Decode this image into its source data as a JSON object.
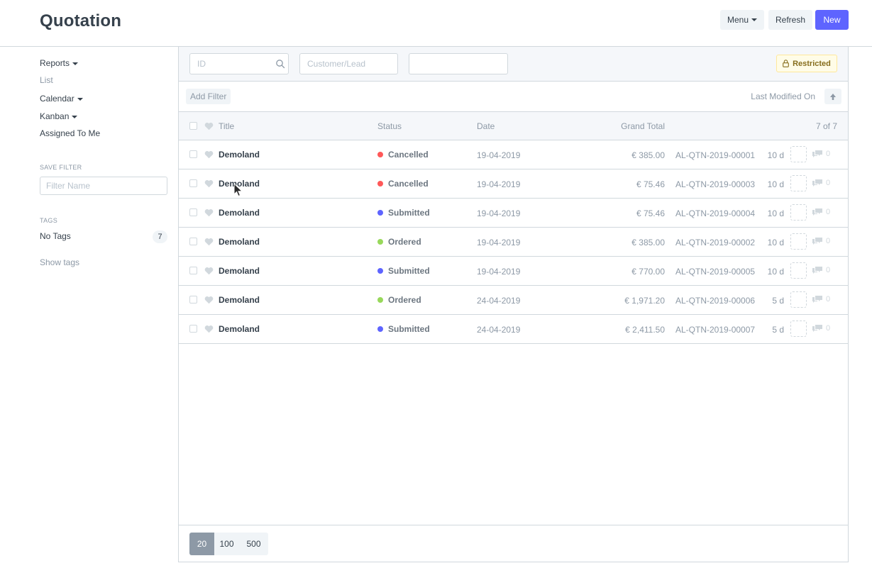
{
  "header": {
    "title": "Quotation",
    "menu_label": "Menu",
    "refresh_label": "Refresh",
    "new_label": "New"
  },
  "sidebar": {
    "reports": "Reports",
    "list": "List",
    "calendar": "Calendar",
    "kanban": "Kanban",
    "assigned_to_me": "Assigned To Me",
    "save_filter_heading": "SAVE FILTER",
    "filter_name_placeholder": "Filter Name",
    "tags_heading": "TAGS",
    "no_tags": "No Tags",
    "no_tags_count": "7",
    "show_tags": "Show tags"
  },
  "filters": {
    "id_placeholder": "ID",
    "customer_placeholder": "Customer/Lead",
    "third_placeholder": "",
    "restricted_label": "Restricted",
    "add_filter": "Add Filter",
    "sort_label": "Last Modified On"
  },
  "list": {
    "columns": {
      "title": "Title",
      "status": "Status",
      "date": "Date",
      "grand_total": "Grand Total",
      "count": "7 of 7"
    },
    "rows": [
      {
        "title": "Demoland",
        "status": "Cancelled",
        "status_color": "#ff5858",
        "date": "19-04-2019",
        "total": "€ 385.00",
        "name": "AL-QTN-2019-00001",
        "modified": "10 d",
        "comments": "0"
      },
      {
        "title": "Demoland",
        "status": "Cancelled",
        "status_color": "#ff5858",
        "date": "19-04-2019",
        "total": "€ 75.46",
        "name": "AL-QTN-2019-00003",
        "modified": "10 d",
        "comments": "0"
      },
      {
        "title": "Demoland",
        "status": "Submitted",
        "status_color": "#5e64ff",
        "date": "19-04-2019",
        "total": "€ 75.46",
        "name": "AL-QTN-2019-00004",
        "modified": "10 d",
        "comments": "0"
      },
      {
        "title": "Demoland",
        "status": "Ordered",
        "status_color": "#98d85b",
        "date": "19-04-2019",
        "total": "€ 385.00",
        "name": "AL-QTN-2019-00002",
        "modified": "10 d",
        "comments": "0"
      },
      {
        "title": "Demoland",
        "status": "Submitted",
        "status_color": "#5e64ff",
        "date": "19-04-2019",
        "total": "€ 770.00",
        "name": "AL-QTN-2019-00005",
        "modified": "10 d",
        "comments": "0"
      },
      {
        "title": "Demoland",
        "status": "Ordered",
        "status_color": "#98d85b",
        "date": "24-04-2019",
        "total": "€ 1,971.20",
        "name": "AL-QTN-2019-00006",
        "modified": "5 d",
        "comments": "0"
      },
      {
        "title": "Demoland",
        "status": "Submitted",
        "status_color": "#5e64ff",
        "date": "24-04-2019",
        "total": "€ 2,411.50",
        "name": "AL-QTN-2019-00007",
        "modified": "5 d",
        "comments": "0"
      }
    ]
  },
  "pager": {
    "options": [
      "20",
      "100",
      "500"
    ]
  },
  "icons": {
    "search": "search-icon",
    "lock": "lock-icon",
    "heart": "heart-icon",
    "comment": "comment-icon",
    "sort": "sort-ascending-icon",
    "cursor": "mouse-cursor"
  }
}
